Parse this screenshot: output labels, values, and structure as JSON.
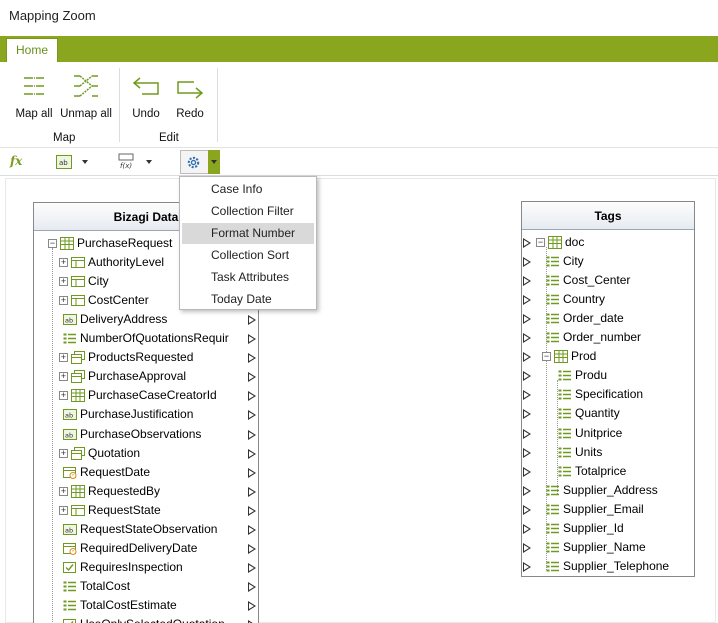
{
  "window": {
    "title": "Mapping Zoom"
  },
  "ribbon": {
    "tabs": [
      {
        "label": "Home",
        "active": true
      }
    ],
    "groups": [
      {
        "label": "Map",
        "buttons": [
          {
            "label": "Map all",
            "icon": "map-all-icon"
          },
          {
            "label": "Unmap all",
            "icon": "unmap-all-icon"
          }
        ]
      },
      {
        "label": "Edit",
        "buttons": [
          {
            "label": "Undo",
            "icon": "undo-icon"
          },
          {
            "label": "Redo",
            "icon": "redo-icon"
          }
        ]
      }
    ]
  },
  "toolbar": {
    "fx_label": "fx",
    "gear_menu_items": [
      {
        "label": "Case Info",
        "selected": false
      },
      {
        "label": "Collection Filter",
        "selected": false
      },
      {
        "label": "Format Number",
        "selected": true
      },
      {
        "label": "Collection Sort",
        "selected": false
      },
      {
        "label": "Task Attributes",
        "selected": false
      },
      {
        "label": "Today Date",
        "selected": false
      }
    ]
  },
  "left_panel": {
    "title": "Bizagi Data",
    "rows": [
      {
        "label": "PurchaseRequest",
        "level": 0,
        "expander": "-",
        "icon": "entity"
      },
      {
        "label": "AuthorityLevel",
        "level": 1,
        "expander": "+",
        "icon": "table"
      },
      {
        "label": "City",
        "level": 1,
        "expander": "+",
        "icon": "table"
      },
      {
        "label": "CostCenter",
        "level": 1,
        "expander": "+",
        "icon": "table"
      },
      {
        "label": "DeliveryAddress",
        "level": 1,
        "expander": "",
        "icon": "text"
      },
      {
        "label": "NumberOfQuotationsRequir",
        "level": 1,
        "expander": "",
        "icon": "number"
      },
      {
        "label": "ProductsRequested",
        "level": 1,
        "expander": "+",
        "icon": "collection"
      },
      {
        "label": "PurchaseApproval",
        "level": 1,
        "expander": "+",
        "icon": "collection"
      },
      {
        "label": "PurchaseCaseCreatorId",
        "level": 1,
        "expander": "+",
        "icon": "entity"
      },
      {
        "label": "PurchaseJustification",
        "level": 1,
        "expander": "",
        "icon": "text"
      },
      {
        "label": "PurchaseObservations",
        "level": 1,
        "expander": "",
        "icon": "text"
      },
      {
        "label": "Quotation",
        "level": 1,
        "expander": "+",
        "icon": "collection"
      },
      {
        "label": "RequestDate",
        "level": 1,
        "expander": "",
        "icon": "date"
      },
      {
        "label": "RequestedBy",
        "level": 1,
        "expander": "+",
        "icon": "entity"
      },
      {
        "label": "RequestState",
        "level": 1,
        "expander": "+",
        "icon": "table"
      },
      {
        "label": "RequestStateObservation",
        "level": 1,
        "expander": "",
        "icon": "text"
      },
      {
        "label": "RequiredDeliveryDate",
        "level": 1,
        "expander": "",
        "icon": "date"
      },
      {
        "label": "RequiresInspection",
        "level": 1,
        "expander": "",
        "icon": "boolean"
      },
      {
        "label": "TotalCost",
        "level": 1,
        "expander": "",
        "icon": "number"
      },
      {
        "label": "TotalCostEstimate",
        "level": 1,
        "expander": "",
        "icon": "number"
      },
      {
        "label": "UseOnlySelectedQuotation",
        "level": 1,
        "expander": "",
        "icon": "boolean"
      }
    ]
  },
  "right_panel": {
    "title": "Tags",
    "rows": [
      {
        "label": "doc",
        "level": 0,
        "expander": "-",
        "icon": "entity"
      },
      {
        "label": "City",
        "level": 1,
        "expander": "",
        "icon": "number"
      },
      {
        "label": "Cost_Center",
        "level": 1,
        "expander": "",
        "icon": "number"
      },
      {
        "label": "Country",
        "level": 1,
        "expander": "",
        "icon": "number"
      },
      {
        "label": "Order_date",
        "level": 1,
        "expander": "",
        "icon": "number"
      },
      {
        "label": "Order_number",
        "level": 1,
        "expander": "",
        "icon": "number"
      },
      {
        "label": "Prod",
        "level": 1,
        "expander": "-",
        "icon": "entity"
      },
      {
        "label": "Produ",
        "level": 2,
        "expander": "",
        "icon": "number"
      },
      {
        "label": "Specification",
        "level": 2,
        "expander": "",
        "icon": "number"
      },
      {
        "label": "Quantity",
        "level": 2,
        "expander": "",
        "icon": "number"
      },
      {
        "label": "Unitprice",
        "level": 2,
        "expander": "",
        "icon": "number"
      },
      {
        "label": "Units",
        "level": 2,
        "expander": "",
        "icon": "number"
      },
      {
        "label": "Totalprice",
        "level": 2,
        "expander": "",
        "icon": "number"
      },
      {
        "label": "Supplier_Address",
        "level": 1,
        "expander": "",
        "icon": "number"
      },
      {
        "label": "Supplier_Email",
        "level": 1,
        "expander": "",
        "icon": "number"
      },
      {
        "label": "Supplier_Id",
        "level": 1,
        "expander": "",
        "icon": "number"
      },
      {
        "label": "Supplier_Name",
        "level": 1,
        "expander": "",
        "icon": "number"
      },
      {
        "label": "Supplier_Telephone",
        "level": 1,
        "expander": "",
        "icon": "number"
      }
    ]
  },
  "colors": {
    "accent": "#8aa61e",
    "icon_green": "#6f9a1f",
    "icon_blue": "#2e6fb5"
  }
}
